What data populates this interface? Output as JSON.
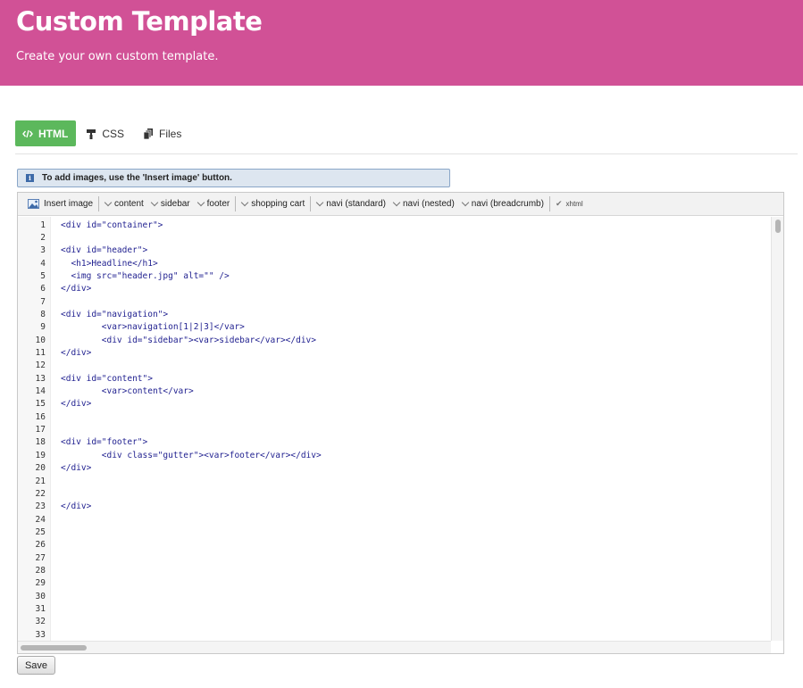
{
  "header": {
    "title": "Custom Template",
    "subtitle": "Create your own custom template."
  },
  "tabs": [
    {
      "label": "HTML",
      "icon": "code-icon",
      "active": true
    },
    {
      "label": "CSS",
      "icon": "paint-roller-icon",
      "active": false
    },
    {
      "label": "Files",
      "icon": "files-icon",
      "active": false
    }
  ],
  "notice": {
    "text": "To add images, use the 'Insert image' button.",
    "icon": "info-icon"
  },
  "toolbar": {
    "insert_image": "Insert image",
    "content": "content",
    "sidebar": "sidebar",
    "footer": "footer",
    "shopping_cart": "shopping cart",
    "navi_standard": "navi (standard)",
    "navi_nested": "navi (nested)",
    "navi_breadcrumb": "navi (breadcrumb)",
    "xhtml": "xhtml"
  },
  "editor": {
    "line_numbers": [
      "1",
      "2",
      "3",
      "4",
      "5",
      "6",
      "7",
      "8",
      "9",
      "10",
      "11",
      "12",
      "13",
      "14",
      "15",
      "16",
      "17",
      "18",
      "19",
      "20",
      "21",
      "22",
      "23",
      "24",
      "25",
      "26",
      "27",
      "28",
      "29",
      "30",
      "31",
      "32",
      "33"
    ],
    "lines": [
      "<div id=\"container\">",
      "",
      "<div id=\"header\">",
      "  <h1>Headline</h1>",
      "  <img src=\"header.jpg\" alt=\"\" />",
      "</div>",
      "",
      "<div id=\"navigation\">",
      "        <var>navigation[1|2|3]</var>",
      "        <div id=\"sidebar\"><var>sidebar</var></div>",
      "</div>",
      "",
      "<div id=\"content\">",
      "        <var>content</var>",
      "</div>",
      "",
      "",
      "<div id=\"footer\">",
      "        <div class=\"gutter\"><var>footer</var></div>",
      "</div>",
      "",
      "",
      "</div>",
      "",
      "",
      "",
      "",
      "",
      "",
      "",
      "",
      "",
      ""
    ]
  },
  "save_label": "Save",
  "colors": {
    "banner": "#d15196",
    "active_tab": "#5cb85c",
    "code_text": "#1f1f8f"
  }
}
